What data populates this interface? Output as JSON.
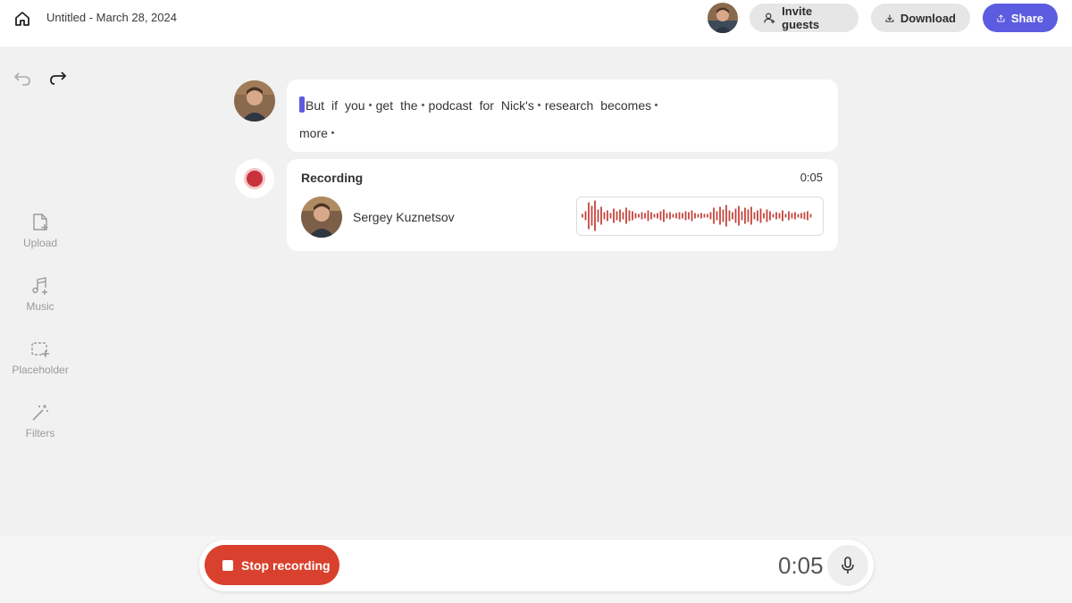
{
  "header": {
    "doc_title": "Untitled - March 28, 2024",
    "invite_label": "Invite guests",
    "download_label": "Download",
    "share_label": "Share",
    "accent_color": "#5c5ce0"
  },
  "sidebar": {
    "tools": [
      {
        "label": "Upload",
        "icon": "upload-file-icon"
      },
      {
        "label": "Music",
        "icon": "music-add-icon"
      },
      {
        "label": "Placeholder",
        "icon": "placeholder-icon"
      },
      {
        "label": "Filters",
        "icon": "magic-wand-icon"
      }
    ]
  },
  "transcript": {
    "line1": [
      "But",
      "if",
      "you",
      "get",
      "the",
      "podcast",
      "for",
      "Nick's",
      "research",
      "becomes"
    ],
    "line2": [
      "more"
    ]
  },
  "recording": {
    "label": "Recording",
    "elapsed": "0:05",
    "speaker_name": "Sergey Kuznetsov",
    "waveform_color": "#c4443c"
  },
  "controls": {
    "stop_label": "Stop recording",
    "timer": "0:05",
    "stop_color": "#d9412e"
  }
}
